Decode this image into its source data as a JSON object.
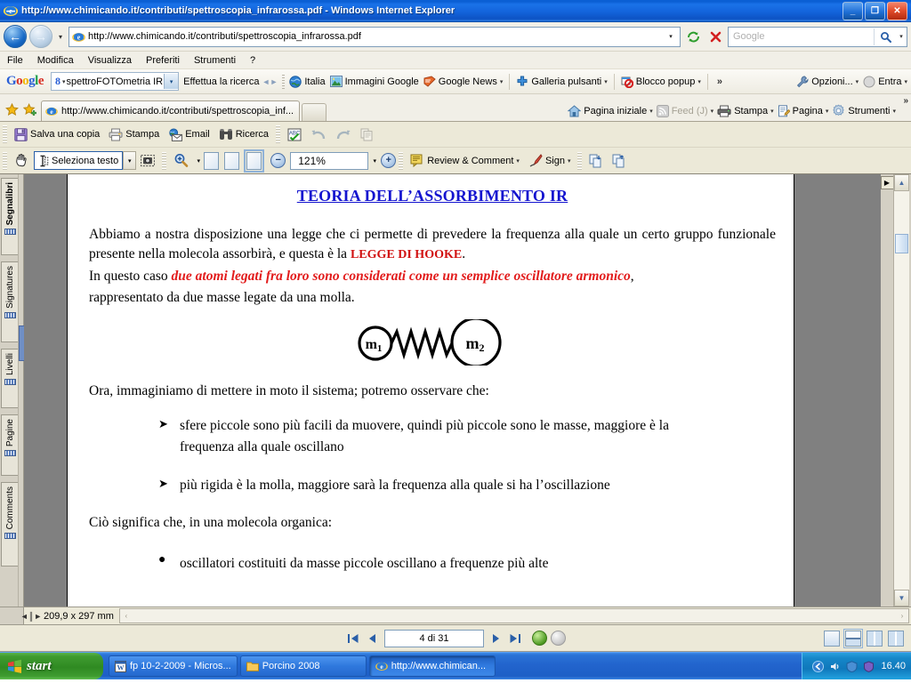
{
  "window": {
    "title": "http://www.chimicando.it/contributi/spettroscopia_infrarossa.pdf - Windows Internet Explorer",
    "minimize_label": "_",
    "restore_label": "❐",
    "close_label": "✕"
  },
  "addressbar": {
    "back_label": "←",
    "forward_label": "→",
    "history_arrow": "▾",
    "url": "http://www.chimicando.it/contributi/spettroscopia_infrarossa.pdf",
    "dropdown_arrow": "▾",
    "refresh_label": "↻",
    "stop_label": "✕",
    "search_placeholder": "Google",
    "search_go": "⌕",
    "search_drop": "▾"
  },
  "menubar": {
    "items": [
      "File",
      "Modifica",
      "Visualizza",
      "Preferiti",
      "Strumenti",
      "?"
    ]
  },
  "google_toolbar": {
    "logo": "Google",
    "search_value": "spettroFOTOmetria IR",
    "search_caret": "▾",
    "search_dropdown": "▾",
    "items": [
      {
        "label": "Effettua la ricerca",
        "icon": "search-arrows-icon",
        "has_arrow": false
      },
      {
        "label": "Italia",
        "icon": "globe-icon",
        "has_arrow": false
      },
      {
        "label": "Immagini Google",
        "icon": "image-icon",
        "has_arrow": false
      },
      {
        "label": "Google News",
        "icon": "news-icon",
        "has_arrow": true
      },
      {
        "label": "Galleria pulsanti",
        "icon": "plus-icon",
        "has_arrow": true
      },
      {
        "label": "Blocco popup",
        "icon": "popup-block-icon",
        "has_arrow": true
      }
    ],
    "overflow": "»",
    "right_items": [
      {
        "label": "Opzioni...",
        "icon": "wrench-icon",
        "has_arrow": true
      },
      {
        "label": "Entra",
        "icon": "user-circle-icon",
        "has_arrow": true
      }
    ]
  },
  "tabbar": {
    "tab_label": "http://www.chimicando.it/contributi/spettroscopia_inf...",
    "commands": [
      {
        "label": "Pagina iniziale",
        "icon": "home-icon",
        "has_arrow": true,
        "disabled": false
      },
      {
        "label": "Feed (J)",
        "icon": "feed-icon",
        "has_arrow": true,
        "disabled": true
      },
      {
        "label": "Stampa",
        "icon": "printer-icon",
        "has_arrow": true,
        "disabled": false
      },
      {
        "label": "Pagina",
        "icon": "page-icon",
        "has_arrow": true,
        "disabled": false
      },
      {
        "label": "Strumenti",
        "icon": "gear-icon",
        "has_arrow": true,
        "disabled": false
      }
    ],
    "overflow": "»"
  },
  "acrobat_toolbar_1": {
    "buttons": [
      {
        "label": "Salva una copia",
        "icon": "save-icon",
        "disabled": false
      },
      {
        "label": "Stampa",
        "icon": "printer-icon",
        "disabled": false
      },
      {
        "label": "Email",
        "icon": "email-icon",
        "disabled": false
      },
      {
        "label": "Ricerca",
        "icon": "binoculars-icon",
        "disabled": false
      }
    ],
    "tools": [
      {
        "icon": "spellcheck-icon",
        "disabled": false
      },
      {
        "icon": "undo-icon",
        "disabled": true
      },
      {
        "icon": "redo-icon",
        "disabled": true
      },
      {
        "icon": "copy-icon",
        "disabled": true
      }
    ]
  },
  "acrobat_toolbar_2": {
    "hand_icon": "hand-icon",
    "select_text_label": "Seleziona testo",
    "select_dropdown": "▾",
    "snapshot_icon": "snapshot-icon",
    "zoom_in_icon": "zoom-in-icon",
    "zoom_dropdown": "▾",
    "page_views": [
      "actual-size-icon",
      "fit-width-icon",
      "fit-page-icon"
    ],
    "zoom_out_btn": "−",
    "zoom_value": "121%",
    "zoom_value_drop": "▾",
    "zoom_plus_btn": "+",
    "review_label": "Review & Comment",
    "review_arrow": "▾",
    "sign_label": "Sign",
    "sign_arrow": "▾",
    "nav_prev_icon": "previous-view-icon",
    "nav_next_icon": "next-view-icon"
  },
  "sidebar": {
    "tabs": [
      {
        "label": "Segnalibri",
        "active": true
      },
      {
        "label": "Signatures",
        "active": false
      },
      {
        "label": "Livelli",
        "active": false
      },
      {
        "label": "Pagine",
        "active": false
      },
      {
        "label": "Comments",
        "active": false
      }
    ]
  },
  "document": {
    "title": "TEORIA DELL’ASSORBIMENTO IR",
    "paragraph1_a": "Abbiamo a nostra disposizione una legge che ci permette di prevedere la frequenza alla quale un certo gruppo funzionale presente nella molecola assorbirà, e questa è la ",
    "paragraph1_law": "LEGGE DI HOOKE",
    "paragraph1_b": ".",
    "paragraph2_a": "In questo caso ",
    "paragraph2_em": "due atomi legati fra loro  sono considerati come un semplice oscillatore armonico",
    "paragraph2_b": ",",
    "paragraph3": "rappresentato da due masse legate da una molla.",
    "diagram": {
      "mass1_label": "m",
      "mass1_sub": "1",
      "mass2_label": "m",
      "mass2_sub": "2",
      "spring_name": "spring-coil"
    },
    "paragraph4": "Ora, immaginiamo di mettere in moto il sistema; potremo osservare che:",
    "arrow_bullets": [
      "sfere piccole sono più facili da muovere, quindi più piccole sono le masse, maggiore è la frequenza alla quale oscillano",
      "più rigida è la molla, maggiore sarà la frequenza alla quale si ha l’oscillazione"
    ],
    "arrow_marker": "➤",
    "paragraph5": "Ciò significa che, in una molecola organica:",
    "dot_bullets": [
      "oscillatori costituiti da masse piccole oscillano a frequenze più alte"
    ],
    "dot_marker": "●"
  },
  "status": {
    "resize_icon": "resize-handle-icon",
    "page_size": "209,9 x 297 mm",
    "hscroll_left": "‹",
    "hscroll_right": "›"
  },
  "pagenav": {
    "first_icon": "⏮",
    "prev_icon": "◀",
    "page_value": "4 di 31",
    "next_icon": "▶",
    "last_icon": "⏭",
    "prev_view_icon": "previous-view-circle-icon",
    "next_view_icon": "next-view-circle-icon",
    "view_modes": [
      "single-page-icon",
      "continuous-icon",
      "facing-icon",
      "continuous-facing-icon"
    ],
    "selected_view_mode": 1
  },
  "taskbar": {
    "start_label": "start",
    "tasks": [
      {
        "label": "fp 10-2-2009 - Micros...",
        "icon": "word-icon",
        "active": false
      },
      {
        "label": "Porcino 2008",
        "icon": "folder-icon",
        "active": false
      },
      {
        "label": "http://www.chimican...",
        "icon": "ie-icon",
        "active": true
      }
    ],
    "tray_icons": [
      "network-icon",
      "volume-icon",
      "shield-icon",
      "av-icon"
    ],
    "clock": "16.40"
  },
  "colors": {
    "titlebar_blue": "#1364dc",
    "doc_title_blue": "#1414cf",
    "accent_red": "#d11010",
    "toolbar_bg": "#ece9d8",
    "taskbar_blue": "#2264cd",
    "start_green": "#2f8a22"
  }
}
